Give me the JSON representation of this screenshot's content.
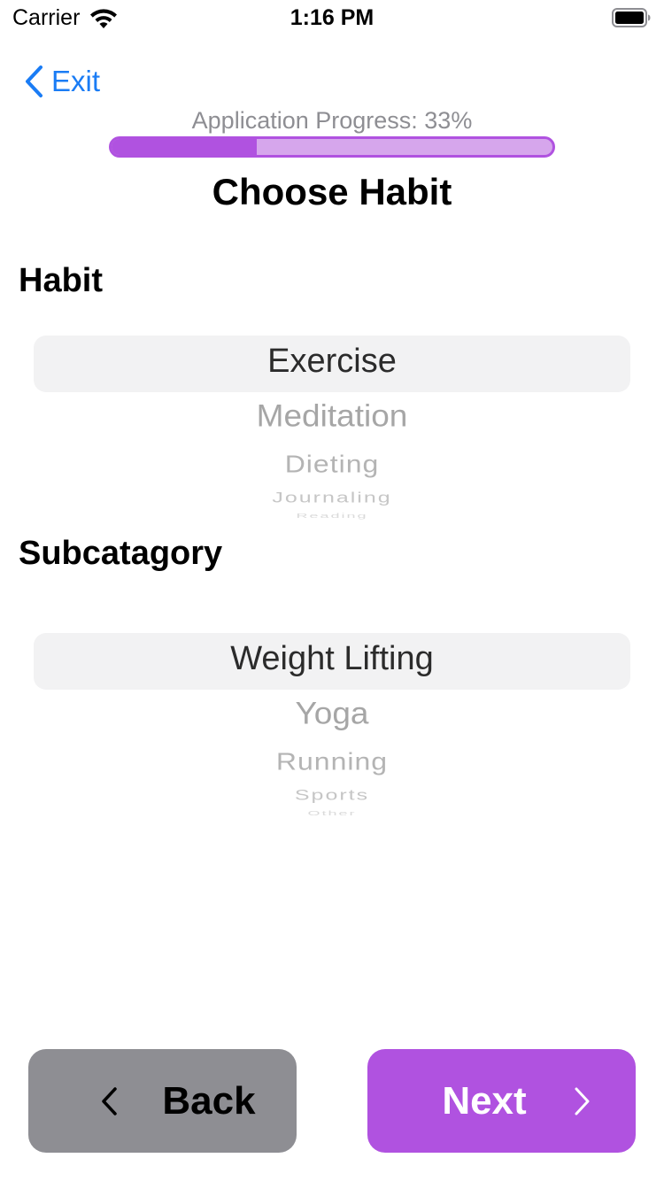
{
  "status_bar": {
    "carrier": "Carrier",
    "time": "1:16 PM",
    "icons": [
      "wifi-icon",
      "battery-icon"
    ]
  },
  "nav": {
    "exit_label": "Exit",
    "exit_icon": "chevron-left-icon",
    "accent_color": "#1a7cf5"
  },
  "progress": {
    "label": "Application Progress: 33%",
    "fraction": 0.33,
    "fill_color": "#b052e0",
    "track_color": "#d6a6ec"
  },
  "page_title": "Choose Habit",
  "habit": {
    "label": "Habit",
    "selected": "Exercise",
    "options": [
      "Exercise",
      "Meditation",
      "Dieting",
      "Journaling",
      "Reading"
    ]
  },
  "subcategory": {
    "label": "Subcatagory",
    "selected": "Weight Lifting",
    "options": [
      "Weight Lifting",
      "Yoga",
      "Running",
      "Sports",
      "Other"
    ]
  },
  "footer": {
    "back_label": "Back",
    "back_icon": "chevron-left-icon",
    "back_color": "#8e8e93",
    "next_label": "Next",
    "next_icon": "chevron-right-icon",
    "next_color": "#b052e0"
  }
}
